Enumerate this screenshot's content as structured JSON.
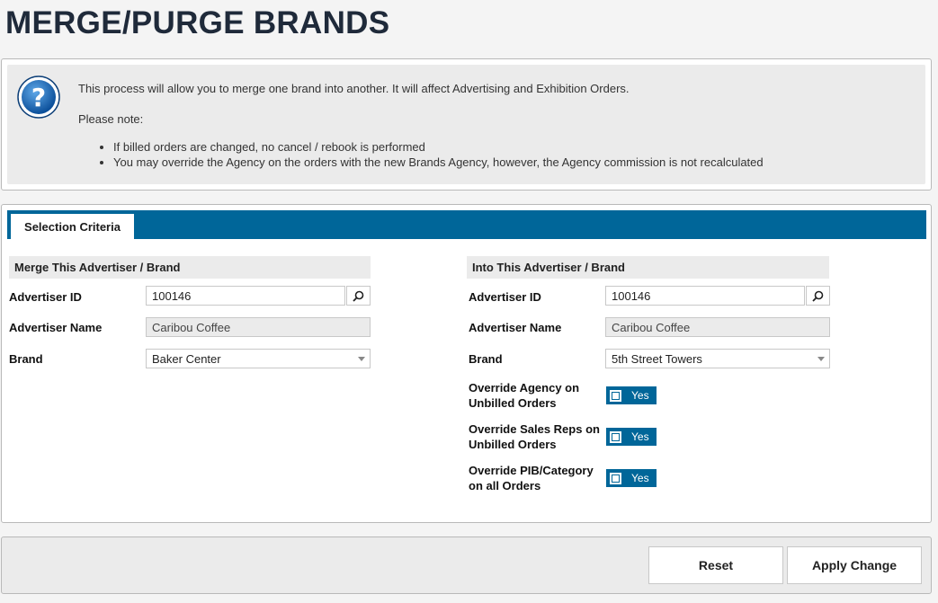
{
  "page": {
    "title": "MERGE/PURGE BRANDS"
  },
  "info": {
    "line1": "This process will allow you to merge one brand into another. It will affect Advertising and Exhibition Orders.",
    "note": "Please note:",
    "bullets": [
      "If billed orders are changed, no cancel / rebook is performed",
      "You may override the Agency on the orders with the new Brands Agency, however, the Agency commission is not recalculated"
    ]
  },
  "tabs": {
    "selection_criteria": "Selection Criteria"
  },
  "merge": {
    "header": "Merge This Advertiser / Brand",
    "advertiser_id_label": "Advertiser ID",
    "advertiser_id_value": "100146",
    "advertiser_name_label": "Advertiser Name",
    "advertiser_name_value": "Caribou Coffee",
    "brand_label": "Brand",
    "brand_value": "Baker Center"
  },
  "into": {
    "header": "Into This Advertiser / Brand",
    "advertiser_id_label": "Advertiser ID",
    "advertiser_id_value": "100146",
    "advertiser_name_label": "Advertiser Name",
    "advertiser_name_value": "Caribou Coffee",
    "brand_label": "Brand",
    "brand_value": "5th Street Towers",
    "override_agency_label_1": "Override Agency on",
    "override_agency_label_2": "Unbilled Orders",
    "override_agency_value": "Yes",
    "override_sales_label_1": "Override Sales Reps on",
    "override_sales_label_2": "Unbilled Orders",
    "override_sales_value": "Yes",
    "override_pib_label_1": "Override PIB/Category",
    "override_pib_label_2": "on all Orders",
    "override_pib_value": "Yes"
  },
  "actions": {
    "reset": "Reset",
    "apply": "Apply Change"
  },
  "colors": {
    "accent": "#006699",
    "panel_bg": "#ebebeb",
    "title": "#1f2a3a"
  },
  "icons": {
    "help": "question-circle-icon",
    "lookup": "magnifier-icon",
    "dropdown": "caret-down-icon"
  }
}
